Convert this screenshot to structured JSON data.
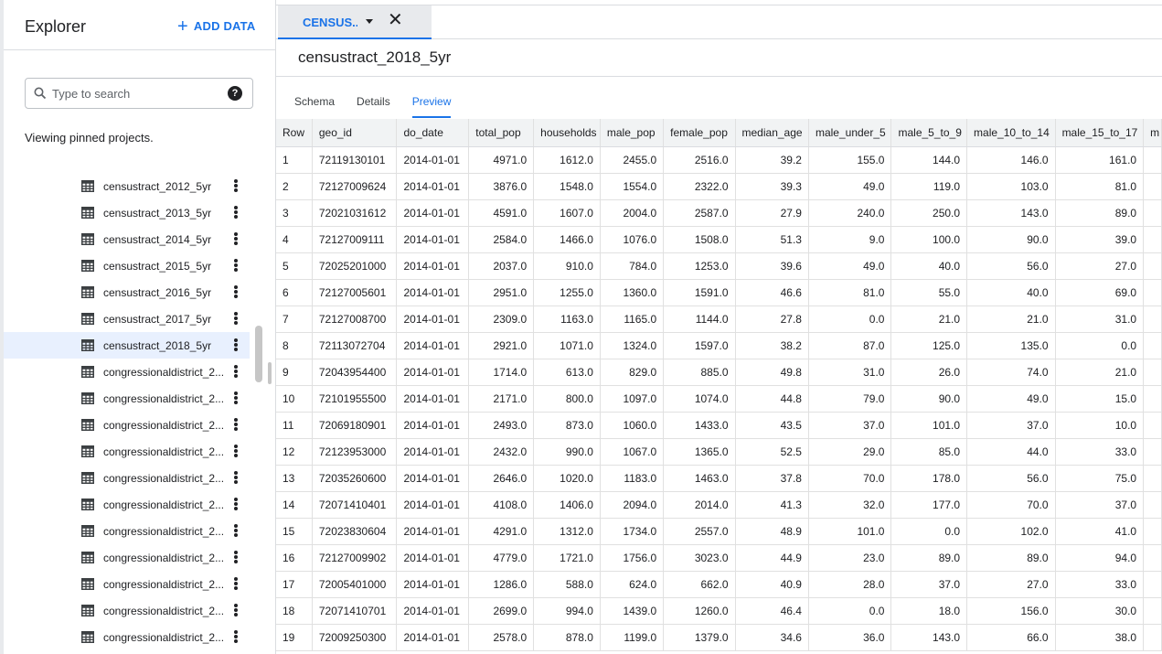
{
  "explorer": {
    "title": "Explorer",
    "add_data_label": "ADD DATA",
    "search_placeholder": "Type to search",
    "viewing_text": "Viewing pinned projects.",
    "items": [
      {
        "label": "censustract_2012_5yr"
      },
      {
        "label": "censustract_2013_5yr"
      },
      {
        "label": "censustract_2014_5yr"
      },
      {
        "label": "censustract_2015_5yr"
      },
      {
        "label": "censustract_2016_5yr"
      },
      {
        "label": "censustract_2017_5yr"
      },
      {
        "label": "censustract_2018_5yr",
        "selected": true
      },
      {
        "label": "congressionaldistrict_2..."
      },
      {
        "label": "congressionaldistrict_2..."
      },
      {
        "label": "congressionaldistrict_2..."
      },
      {
        "label": "congressionaldistrict_2..."
      },
      {
        "label": "congressionaldistrict_2..."
      },
      {
        "label": "congressionaldistrict_2..."
      },
      {
        "label": "congressionaldistrict_2..."
      },
      {
        "label": "congressionaldistrict_2..."
      },
      {
        "label": "congressionaldistrict_2..."
      },
      {
        "label": "congressionaldistrict_2..."
      },
      {
        "label": "congressionaldistrict_2..."
      }
    ]
  },
  "tab": {
    "label": "CENSUS...",
    "close_glyph": "✕"
  },
  "dataset": {
    "title": "censustract_2018_5yr"
  },
  "subtabs": [
    {
      "label": "Schema"
    },
    {
      "label": "Details"
    },
    {
      "label": "Preview",
      "active": true
    }
  ],
  "table": {
    "columns": [
      "Row",
      "geo_id",
      "do_date",
      "total_pop",
      "households",
      "male_pop",
      "female_pop",
      "median_age",
      "male_under_5",
      "male_5_to_9",
      "male_10_to_14",
      "male_15_to_17",
      "m"
    ],
    "rows": [
      [
        "1",
        "72119130101",
        "2014-01-01",
        "4971.0",
        "1612.0",
        "2455.0",
        "2516.0",
        "39.2",
        "155.0",
        "144.0",
        "146.0",
        "161.0",
        ""
      ],
      [
        "2",
        "72127009624",
        "2014-01-01",
        "3876.0",
        "1548.0",
        "1554.0",
        "2322.0",
        "39.3",
        "49.0",
        "119.0",
        "103.0",
        "81.0",
        ""
      ],
      [
        "3",
        "72021031612",
        "2014-01-01",
        "4591.0",
        "1607.0",
        "2004.0",
        "2587.0",
        "27.9",
        "240.0",
        "250.0",
        "143.0",
        "89.0",
        ""
      ],
      [
        "4",
        "72127009111",
        "2014-01-01",
        "2584.0",
        "1466.0",
        "1076.0",
        "1508.0",
        "51.3",
        "9.0",
        "100.0",
        "90.0",
        "39.0",
        ""
      ],
      [
        "5",
        "72025201000",
        "2014-01-01",
        "2037.0",
        "910.0",
        "784.0",
        "1253.0",
        "39.6",
        "49.0",
        "40.0",
        "56.0",
        "27.0",
        ""
      ],
      [
        "6",
        "72127005601",
        "2014-01-01",
        "2951.0",
        "1255.0",
        "1360.0",
        "1591.0",
        "46.6",
        "81.0",
        "55.0",
        "40.0",
        "69.0",
        ""
      ],
      [
        "7",
        "72127008700",
        "2014-01-01",
        "2309.0",
        "1163.0",
        "1165.0",
        "1144.0",
        "27.8",
        "0.0",
        "21.0",
        "21.0",
        "31.0",
        ""
      ],
      [
        "8",
        "72113072704",
        "2014-01-01",
        "2921.0",
        "1071.0",
        "1324.0",
        "1597.0",
        "38.2",
        "87.0",
        "125.0",
        "135.0",
        "0.0",
        ""
      ],
      [
        "9",
        "72043954400",
        "2014-01-01",
        "1714.0",
        "613.0",
        "829.0",
        "885.0",
        "49.8",
        "31.0",
        "26.0",
        "74.0",
        "21.0",
        ""
      ],
      [
        "10",
        "72101955500",
        "2014-01-01",
        "2171.0",
        "800.0",
        "1097.0",
        "1074.0",
        "44.8",
        "79.0",
        "90.0",
        "49.0",
        "15.0",
        ""
      ],
      [
        "11",
        "72069180901",
        "2014-01-01",
        "2493.0",
        "873.0",
        "1060.0",
        "1433.0",
        "43.5",
        "37.0",
        "101.0",
        "37.0",
        "10.0",
        ""
      ],
      [
        "12",
        "72123953000",
        "2014-01-01",
        "2432.0",
        "990.0",
        "1067.0",
        "1365.0",
        "52.5",
        "29.0",
        "85.0",
        "44.0",
        "33.0",
        ""
      ],
      [
        "13",
        "72035260600",
        "2014-01-01",
        "2646.0",
        "1020.0",
        "1183.0",
        "1463.0",
        "37.8",
        "70.0",
        "178.0",
        "56.0",
        "75.0",
        ""
      ],
      [
        "14",
        "72071410401",
        "2014-01-01",
        "4108.0",
        "1406.0",
        "2094.0",
        "2014.0",
        "41.3",
        "32.0",
        "177.0",
        "70.0",
        "37.0",
        ""
      ],
      [
        "15",
        "72023830604",
        "2014-01-01",
        "4291.0",
        "1312.0",
        "1734.0",
        "2557.0",
        "48.9",
        "101.0",
        "0.0",
        "102.0",
        "41.0",
        ""
      ],
      [
        "16",
        "72127009902",
        "2014-01-01",
        "4779.0",
        "1721.0",
        "1756.0",
        "3023.0",
        "44.9",
        "23.0",
        "89.0",
        "89.0",
        "94.0",
        ""
      ],
      [
        "17",
        "72005401000",
        "2014-01-01",
        "1286.0",
        "588.0",
        "624.0",
        "662.0",
        "40.9",
        "28.0",
        "37.0",
        "27.0",
        "33.0",
        ""
      ],
      [
        "18",
        "72071410701",
        "2014-01-01",
        "2699.0",
        "994.0",
        "1439.0",
        "1260.0",
        "46.4",
        "0.0",
        "18.0",
        "156.0",
        "30.0",
        ""
      ],
      [
        "19",
        "72009250300",
        "2014-01-01",
        "2578.0",
        "878.0",
        "1199.0",
        "1379.0",
        "34.6",
        "36.0",
        "143.0",
        "66.0",
        "38.0",
        ""
      ]
    ]
  },
  "colors": {
    "accent": "#1a73e8",
    "selected_row": "#e8f0fe",
    "header_bg": "#f1f3f4"
  }
}
